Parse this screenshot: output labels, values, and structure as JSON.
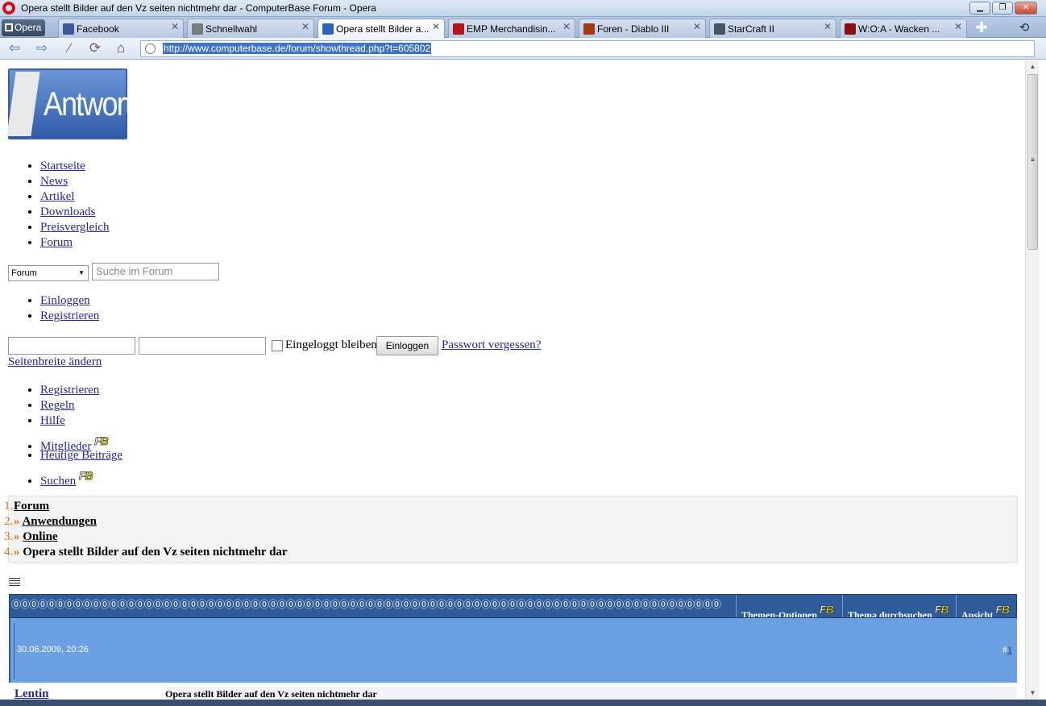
{
  "window": {
    "title": "Opera stellt Bilder auf den Vz seiten nichtmehr dar - ComputerBase Forum - Opera"
  },
  "tabs": {
    "menu_label": "Opera",
    "items": [
      {
        "label": "Facebook",
        "icon": "facebook-icon",
        "color": "#3b5998"
      },
      {
        "label": "Schnellwahl",
        "icon": "speed-dial-icon",
        "color": "#7a7a7a"
      },
      {
        "label": "Opera stellt Bilder a...",
        "icon": "opera-icon",
        "color": "#2f64b8",
        "active": true
      },
      {
        "label": "EMP Merchandisin...",
        "icon": "emp-icon",
        "color": "#b41616"
      },
      {
        "label": "Foren - Diablo III",
        "icon": "diablo-icon",
        "color": "#a33a10"
      },
      {
        "label": "StarCraft II",
        "icon": "starcraft-icon",
        "color": "#445566"
      },
      {
        "label": "W:O:A - Wacken ...",
        "icon": "wacken-icon",
        "color": "#8b1111"
      }
    ]
  },
  "address": {
    "url": "http://www.computerbase.de/forum/showthread.php?t=605802"
  },
  "logo": {
    "text": "Antwort"
  },
  "nav": {
    "items": [
      "Startseite",
      "News",
      "Artikel",
      "Downloads",
      "Preisvergleich",
      "Forum"
    ]
  },
  "search": {
    "select_value": "Forum",
    "placeholder": "Suche im Forum"
  },
  "account": {
    "items": [
      "Einloggen",
      "Registrieren"
    ]
  },
  "login": {
    "remember_label": "Eingeloggt bleiben",
    "button_label": "Einloggen",
    "forgot_label": "Passwort vergessen?",
    "width_label": "Seitenbreite ändern"
  },
  "secondary_nav": {
    "items": [
      "Registrieren",
      "Regeln",
      "Hilfe",
      "Mitglieder",
      "Heutige Beiträge",
      "Suchen"
    ],
    "fb_badge": "FB"
  },
  "breadcrumb": {
    "items": [
      {
        "num": "1.",
        "label": "Forum",
        "link": true
      },
      {
        "num": "2.",
        "label": "Anwendungen",
        "link": true
      },
      {
        "num": "3.",
        "label": "Online",
        "link": true
      },
      {
        "num": "4.",
        "label": "Opera stellt Bilder auf den Vz seiten nichtmehr dar",
        "link": false
      }
    ],
    "separator": "»"
  },
  "thread_toolbar": {
    "pattern": "⓪⓪⓪⓪⓪⓪⓪⓪⓪⓪⓪⓪⓪⓪⓪⓪⓪⓪⓪⓪⓪⓪⓪⓪⓪⓪⓪⓪⓪⓪⓪⓪⓪⓪⓪⓪⓪⓪⓪⓪⓪⓪⓪⓪⓪⓪⓪⓪⓪⓪⓪⓪⓪⓪⓪⓪⓪⓪⓪⓪⓪⓪⓪⓪⓪⓪⓪⓪⓪⓪⓪⓪⓪⓪⓪⓪⓪⓪⓪⓪",
    "options_label": "Themen-Optionen",
    "search_label": "Thema durchsuchen",
    "view_label": "Ansicht"
  },
  "post": {
    "date": "30.06.2009, 20:26",
    "number_prefix": "#",
    "number": "1",
    "author": "Lentin",
    "title": "Opera stellt Bilder auf den Vz seiten nichtmehr dar"
  }
}
